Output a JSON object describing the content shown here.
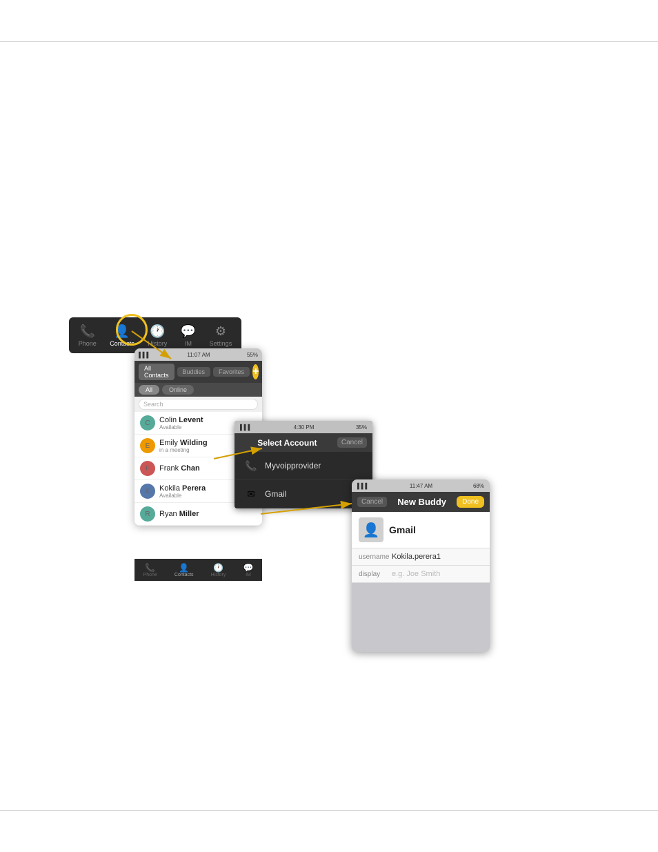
{
  "page": {
    "background": "#ffffff"
  },
  "tab_bar_1": {
    "tabs": [
      {
        "label": "Phone",
        "icon": "📞",
        "active": false
      },
      {
        "label": "Contacts",
        "icon": "👤",
        "active": true
      },
      {
        "label": "History",
        "icon": "🕐",
        "active": false
      },
      {
        "label": "IM",
        "icon": "💬",
        "active": false
      },
      {
        "label": "Settings",
        "icon": "⚙",
        "active": false
      }
    ]
  },
  "contacts_screen": {
    "status_bar": {
      "signal": "▌▌▌",
      "wifi": "◈",
      "time": "11:07 AM",
      "battery": "55%"
    },
    "tabs": [
      "All Contacts",
      "Buddies",
      "Favorites"
    ],
    "filters": [
      "All",
      "Online"
    ],
    "search_placeholder": "Search",
    "contacts": [
      {
        "first": "Colin",
        "last": "Levent",
        "status": "Available",
        "color": "green"
      },
      {
        "first": "Emily",
        "last": "Wilding",
        "status": "in a meeting",
        "color": "orange"
      },
      {
        "first": "Frank",
        "last": "Chan",
        "status": "",
        "color": "red"
      },
      {
        "first": "Kokila",
        "last": "Perera",
        "status": "Available",
        "color": "blue"
      },
      {
        "first": "Ryan",
        "last": "Miller",
        "status": "",
        "color": "green"
      }
    ]
  },
  "select_account_screen": {
    "status_bar": {
      "signal": "▌▌▌",
      "wifi": "◈",
      "time": "4:30 PM",
      "battery": "35%"
    },
    "title": "Select Account",
    "cancel_label": "Cancel",
    "accounts": [
      {
        "name": "Myvoipprovider",
        "icon": "📞"
      },
      {
        "name": "Gmail",
        "icon": "✉"
      }
    ]
  },
  "new_buddy_screen": {
    "status_bar": {
      "signal": "▌▌▌",
      "wifi": "◈",
      "time": "11:47 AM",
      "battery": "68%"
    },
    "cancel_label": "Cancel",
    "title": "New Buddy",
    "done_label": "Done",
    "account_name": "Gmail",
    "username_label": "username",
    "username_value": "Kokila.perera1",
    "display_label": "display",
    "display_placeholder": "e.g. Joe Smith"
  },
  "tab_bar_2": {
    "tabs": [
      {
        "label": "Phone",
        "icon": "📞",
        "active": false
      },
      {
        "label": "Contacts",
        "icon": "👤",
        "active": true
      },
      {
        "label": "History",
        "icon": "🕐",
        "active": false
      },
      {
        "label": "IM",
        "icon": "💬",
        "active": false
      }
    ]
  }
}
